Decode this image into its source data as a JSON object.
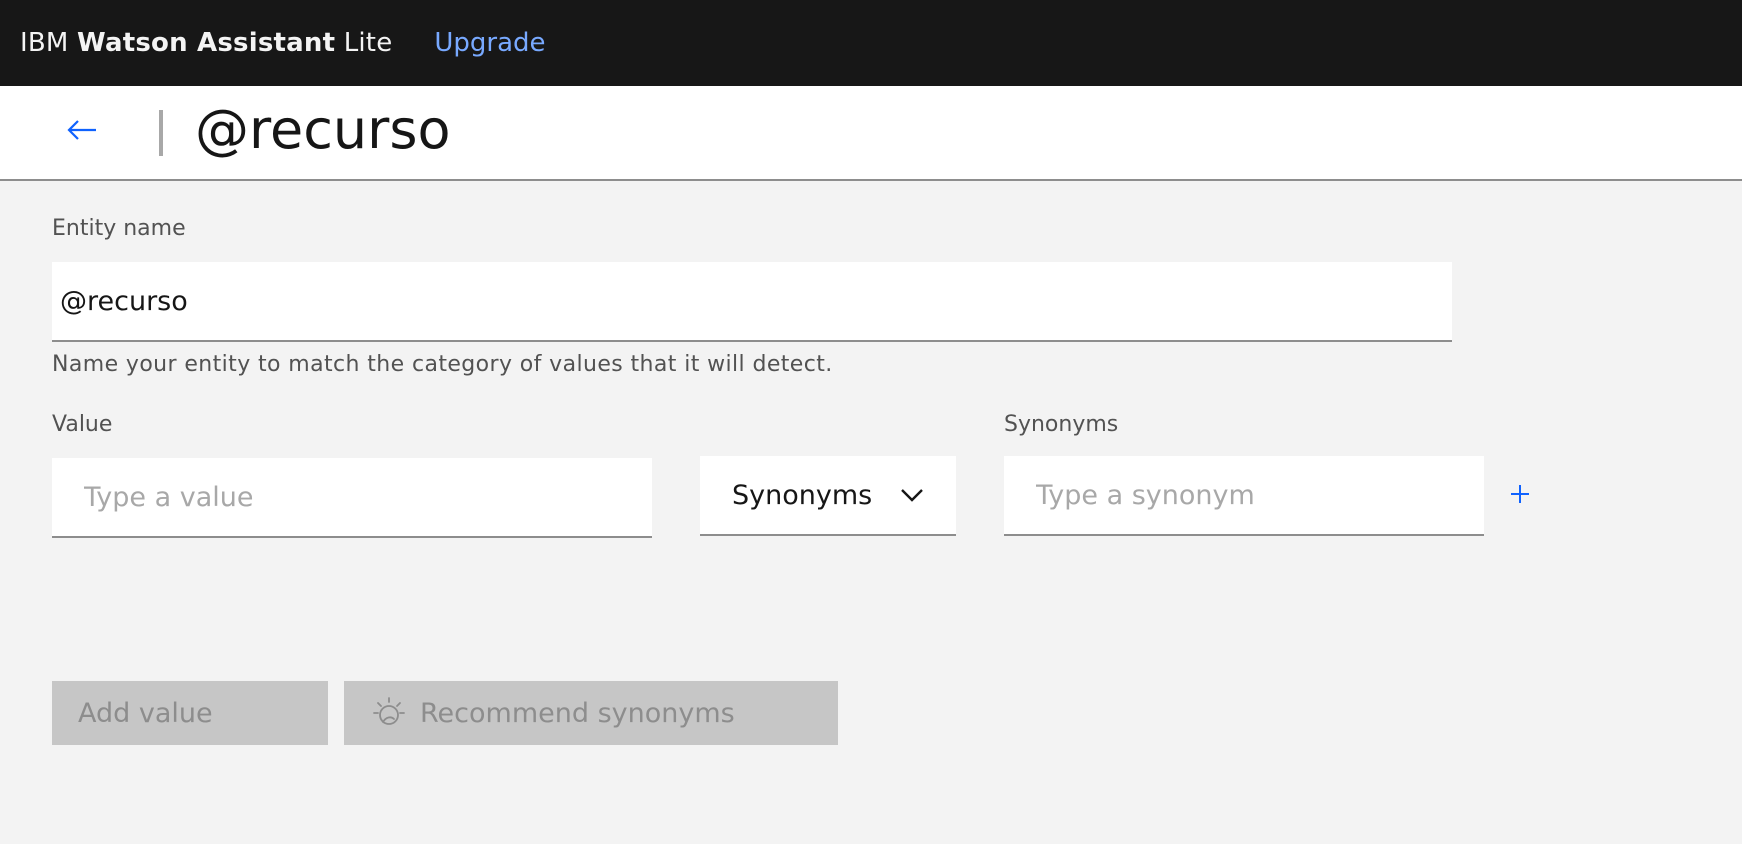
{
  "topbar": {
    "brand_prefix": "IBM",
    "brand_bold": "Watson Assistant",
    "brand_suffix": "Lite",
    "upgrade_label": "Upgrade"
  },
  "header": {
    "back_icon": "arrow-left-icon",
    "title": "@recurso"
  },
  "entity": {
    "label": "Entity name",
    "value": "@recurso",
    "helper": "Name your entity to match the category of values that it will detect."
  },
  "value_field": {
    "label": "Value",
    "placeholder": "Type a value"
  },
  "type_dropdown": {
    "selected": "Synonyms",
    "icon": "chevron-down-icon"
  },
  "synonyms_field": {
    "label": "Synonyms",
    "placeholder": "Type a synonym",
    "add_icon": "plus-icon"
  },
  "actions": {
    "add_value_label": "Add value",
    "recommend_label": "Recommend synonyms",
    "recommend_icon": "watson-lightbulb-icon"
  },
  "colors": {
    "topbar_bg": "#171717",
    "link": "#78a9ff",
    "accent": "#0f62fe",
    "page_bg": "#f3f3f3",
    "disabled_bg": "#c6c6c6",
    "disabled_text": "#8d8d8d"
  }
}
